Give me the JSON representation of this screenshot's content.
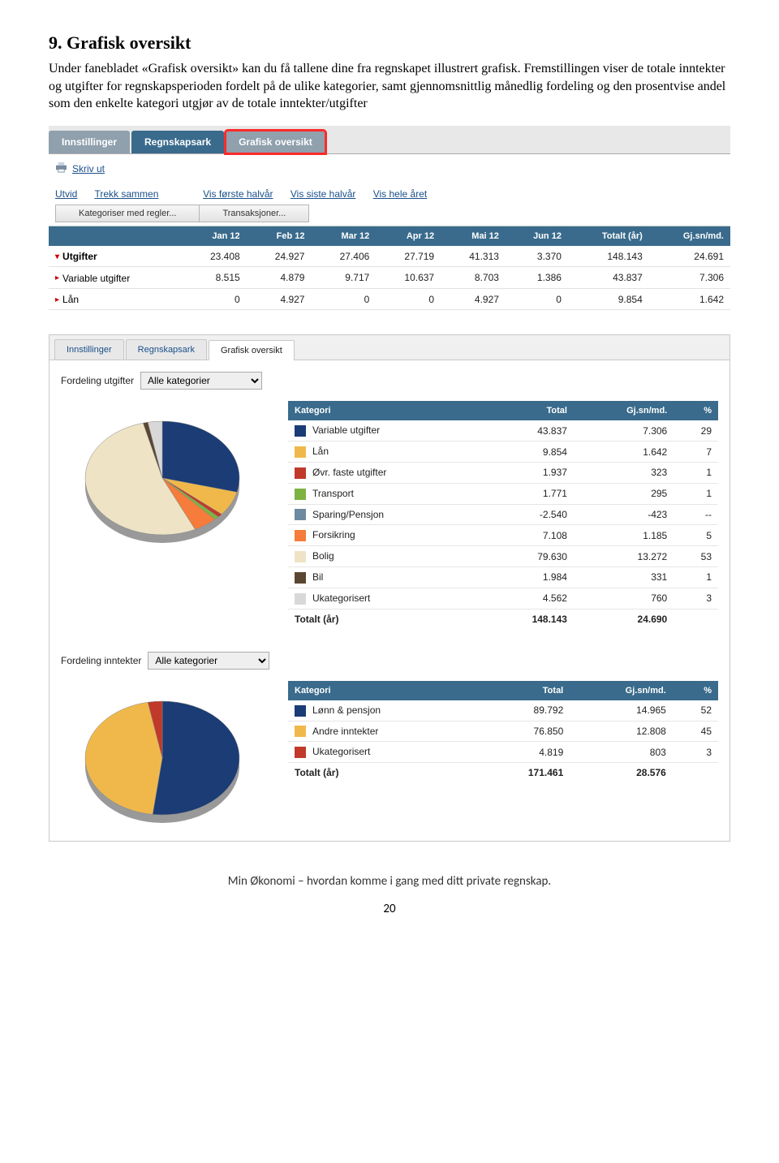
{
  "heading": "9. Grafisk oversikt",
  "paragraph": "Under fanebladet «Grafisk oversikt» kan du få tallene dine fra regnskapet illustrert grafisk. Fremstillingen viser de totale inntekter og utgifter for regnskapsperioden fordelt på de ulike kategorier, samt gjennomsnittlig månedlig fordeling og den prosentvise andel som den enkelte kategori utgjør av de totale inntekter/utgifter",
  "s1": {
    "tabs": [
      "Innstillinger",
      "Regnskapsark",
      "Grafisk oversikt"
    ],
    "print": "Skriv ut",
    "linkrow": [
      "Utvid",
      "Trekk sammen",
      "Vis første halvår",
      "Vis siste halvår",
      "Vis hele året"
    ],
    "buttons": [
      "Kategoriser med regler...",
      "Transaksjoner..."
    ],
    "headers": [
      "",
      "Jan 12",
      "Feb 12",
      "Mar 12",
      "Apr 12",
      "Mai 12",
      "Jun 12",
      "Totalt (år)",
      "Gj.sn/md."
    ],
    "rows": [
      {
        "label": "Utgifter",
        "bold": true,
        "arrow": "down",
        "cells": [
          "23.408",
          "24.927",
          "27.406",
          "27.719",
          "41.313",
          "3.370",
          "148.143",
          "24.691"
        ]
      },
      {
        "label": "Variable utgifter",
        "arrow": "right",
        "cells": [
          "8.515",
          "4.879",
          "9.717",
          "10.637",
          "8.703",
          "1.386",
          "43.837",
          "7.306"
        ]
      },
      {
        "label": "Lån",
        "arrow": "right",
        "cells": [
          "0",
          "4.927",
          "0",
          "0",
          "4.927",
          "0",
          "9.854",
          "1.642"
        ]
      }
    ]
  },
  "s2": {
    "tabs": [
      "Innstillinger",
      "Regnskapsark",
      "Grafisk oversikt"
    ],
    "label_utg": "Fordeling utgifter",
    "label_inn": "Fordeling inntekter",
    "select_value": "Alle kategorier",
    "cat_headers": [
      "Kategori",
      "Total",
      "Gj.sn/md.",
      "%"
    ],
    "utgifter": [
      {
        "color": "#1b3c74",
        "name": "Variable utgifter",
        "total": "43.837",
        "avg": "7.306",
        "pct": "29"
      },
      {
        "color": "#f0b84b",
        "name": "Lån",
        "total": "9.854",
        "avg": "1.642",
        "pct": "7"
      },
      {
        "color": "#c0392b",
        "name": "Øvr. faste utgifter",
        "total": "1.937",
        "avg": "323",
        "pct": "1"
      },
      {
        "color": "#7cb342",
        "name": "Transport",
        "total": "1.771",
        "avg": "295",
        "pct": "1"
      },
      {
        "color": "#6c8aa0",
        "name": "Sparing/Pensjon",
        "total": "-2.540",
        "avg": "-423",
        "pct": "--"
      },
      {
        "color": "#f57c3a",
        "name": "Forsikring",
        "total": "7.108",
        "avg": "1.185",
        "pct": "5"
      },
      {
        "color": "#eee3c5",
        "name": "Bolig",
        "total": "79.630",
        "avg": "13.272",
        "pct": "53"
      },
      {
        "color": "#5a4631",
        "name": "Bil",
        "total": "1.984",
        "avg": "331",
        "pct": "1"
      },
      {
        "color": "#d8d8d8",
        "name": "Ukategorisert",
        "total": "4.562",
        "avg": "760",
        "pct": "3"
      }
    ],
    "utg_total": {
      "label": "Totalt (år)",
      "total": "148.143",
      "avg": "24.690"
    },
    "inntekter": [
      {
        "color": "#1b3c74",
        "name": "Lønn & pensjon",
        "total": "89.792",
        "avg": "14.965",
        "pct": "52"
      },
      {
        "color": "#f0b84b",
        "name": "Andre inntekter",
        "total": "76.850",
        "avg": "12.808",
        "pct": "45"
      },
      {
        "color": "#c0392b",
        "name": "Ukategorisert",
        "total": "4.819",
        "avg": "803",
        "pct": "3"
      }
    ],
    "inn_total": {
      "label": "Totalt (år)",
      "total": "171.461",
      "avg": "28.576"
    }
  },
  "footer": "Min Økonomi – hvordan komme i gang med ditt private regnskap.",
  "page_num": "20",
  "chart_data": [
    {
      "type": "pie",
      "title": "Fordeling utgifter",
      "series": [
        {
          "name": "Variable utgifter",
          "value": 43837,
          "pct": 29,
          "color": "#1b3c74"
        },
        {
          "name": "Lån",
          "value": 9854,
          "pct": 7,
          "color": "#f0b84b"
        },
        {
          "name": "Øvr. faste utgifter",
          "value": 1937,
          "pct": 1,
          "color": "#c0392b"
        },
        {
          "name": "Transport",
          "value": 1771,
          "pct": 1,
          "color": "#7cb342"
        },
        {
          "name": "Forsikring",
          "value": 7108,
          "pct": 5,
          "color": "#f57c3a"
        },
        {
          "name": "Bolig",
          "value": 79630,
          "pct": 53,
          "color": "#eee3c5"
        },
        {
          "name": "Bil",
          "value": 1984,
          "pct": 1,
          "color": "#5a4631"
        },
        {
          "name": "Ukategorisert",
          "value": 4562,
          "pct": 3,
          "color": "#d8d8d8"
        }
      ]
    },
    {
      "type": "pie",
      "title": "Fordeling inntekter",
      "series": [
        {
          "name": "Lønn & pensjon",
          "value": 89792,
          "pct": 52,
          "color": "#1b3c74"
        },
        {
          "name": "Andre inntekter",
          "value": 76850,
          "pct": 45,
          "color": "#f0b84b"
        },
        {
          "name": "Ukategorisert",
          "value": 4819,
          "pct": 3,
          "color": "#c0392b"
        }
      ]
    }
  ]
}
